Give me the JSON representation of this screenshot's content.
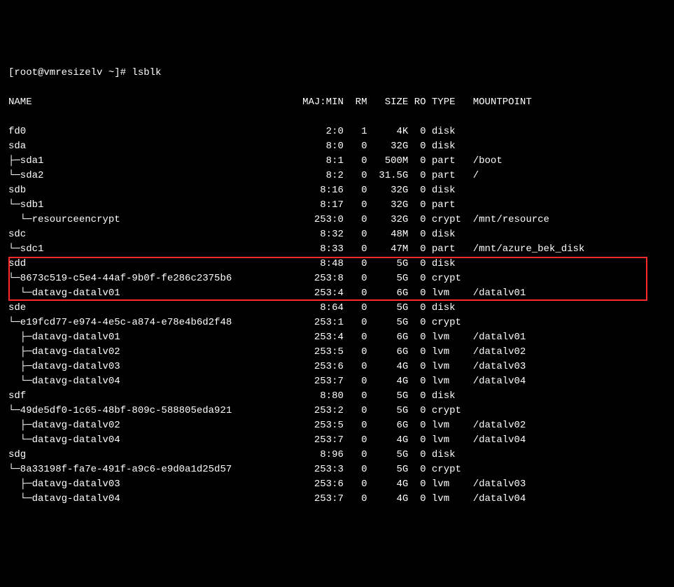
{
  "prompt": "[root@vmresizelv ~]# lsblk",
  "header": {
    "name": "NAME",
    "majmin": "MAJ:MIN",
    "rm": "RM",
    "size": "SIZE",
    "ro": "RO",
    "type": "TYPE",
    "mount": "MOUNTPOINT"
  },
  "rows": [
    {
      "tree": "",
      "name": "fd0",
      "majmin": "2:0",
      "rm": "1",
      "size": "4K",
      "ro": "0",
      "type": "disk",
      "mount": "",
      "hl": ""
    },
    {
      "tree": "",
      "name": "sda",
      "majmin": "8:0",
      "rm": "0",
      "size": "32G",
      "ro": "0",
      "type": "disk",
      "mount": "",
      "hl": ""
    },
    {
      "tree": "├─",
      "name": "sda1",
      "majmin": "8:1",
      "rm": "0",
      "size": "500M",
      "ro": "0",
      "type": "part",
      "mount": "/boot",
      "hl": ""
    },
    {
      "tree": "└─",
      "name": "sda2",
      "majmin": "8:2",
      "rm": "0",
      "size": "31.5G",
      "ro": "0",
      "type": "part",
      "mount": "/",
      "hl": ""
    },
    {
      "tree": "",
      "name": "sdb",
      "majmin": "8:16",
      "rm": "0",
      "size": "32G",
      "ro": "0",
      "type": "disk",
      "mount": "",
      "hl": ""
    },
    {
      "tree": "└─",
      "name": "sdb1",
      "majmin": "8:17",
      "rm": "0",
      "size": "32G",
      "ro": "0",
      "type": "part",
      "mount": "",
      "hl": ""
    },
    {
      "tree": "  └─",
      "name": "resourceencrypt",
      "majmin": "253:0",
      "rm": "0",
      "size": "32G",
      "ro": "0",
      "type": "crypt",
      "mount": "/mnt/resource",
      "hl": ""
    },
    {
      "tree": "",
      "name": "sdc",
      "majmin": "8:32",
      "rm": "0",
      "size": "48M",
      "ro": "0",
      "type": "disk",
      "mount": "",
      "hl": ""
    },
    {
      "tree": "└─",
      "name": "sdc1",
      "majmin": "8:33",
      "rm": "0",
      "size": "47M",
      "ro": "0",
      "type": "part",
      "mount": "/mnt/azure_bek_disk",
      "hl": ""
    },
    {
      "tree": "",
      "name": "sdd",
      "majmin": "8:48",
      "rm": "0",
      "size": "5G",
      "ro": "0",
      "type": "disk",
      "mount": "",
      "hl": "top"
    },
    {
      "tree": "└─",
      "name": "8673c519-c5e4-44af-9b0f-fe286c2375b6",
      "majmin": "253:8",
      "rm": "0",
      "size": "5G",
      "ro": "0",
      "type": "crypt",
      "mount": "",
      "hl": "mid"
    },
    {
      "tree": "  └─",
      "name": "datavg-datalv01",
      "majmin": "253:4",
      "rm": "0",
      "size": "6G",
      "ro": "0",
      "type": "lvm",
      "mount": "/datalv01",
      "hl": "bottom"
    },
    {
      "tree": "",
      "name": "sde",
      "majmin": "8:64",
      "rm": "0",
      "size": "5G",
      "ro": "0",
      "type": "disk",
      "mount": "",
      "hl": ""
    },
    {
      "tree": "└─",
      "name": "e19fcd77-e974-4e5c-a874-e78e4b6d2f48",
      "majmin": "253:1",
      "rm": "0",
      "size": "5G",
      "ro": "0",
      "type": "crypt",
      "mount": "",
      "hl": ""
    },
    {
      "tree": "  ├─",
      "name": "datavg-datalv01",
      "majmin": "253:4",
      "rm": "0",
      "size": "6G",
      "ro": "0",
      "type": "lvm",
      "mount": "/datalv01",
      "hl": ""
    },
    {
      "tree": "  ├─",
      "name": "datavg-datalv02",
      "majmin": "253:5",
      "rm": "0",
      "size": "6G",
      "ro": "0",
      "type": "lvm",
      "mount": "/datalv02",
      "hl": ""
    },
    {
      "tree": "  ├─",
      "name": "datavg-datalv03",
      "majmin": "253:6",
      "rm": "0",
      "size": "4G",
      "ro": "0",
      "type": "lvm",
      "mount": "/datalv03",
      "hl": ""
    },
    {
      "tree": "  └─",
      "name": "datavg-datalv04",
      "majmin": "253:7",
      "rm": "0",
      "size": "4G",
      "ro": "0",
      "type": "lvm",
      "mount": "/datalv04",
      "hl": ""
    },
    {
      "tree": "",
      "name": "sdf",
      "majmin": "8:80",
      "rm": "0",
      "size": "5G",
      "ro": "0",
      "type": "disk",
      "mount": "",
      "hl": ""
    },
    {
      "tree": "└─",
      "name": "49de5df0-1c65-48bf-809c-588805eda921",
      "majmin": "253:2",
      "rm": "0",
      "size": "5G",
      "ro": "0",
      "type": "crypt",
      "mount": "",
      "hl": ""
    },
    {
      "tree": "  ├─",
      "name": "datavg-datalv02",
      "majmin": "253:5",
      "rm": "0",
      "size": "6G",
      "ro": "0",
      "type": "lvm",
      "mount": "/datalv02",
      "hl": ""
    },
    {
      "tree": "  └─",
      "name": "datavg-datalv04",
      "majmin": "253:7",
      "rm": "0",
      "size": "4G",
      "ro": "0",
      "type": "lvm",
      "mount": "/datalv04",
      "hl": ""
    },
    {
      "tree": "",
      "name": "sdg",
      "majmin": "8:96",
      "rm": "0",
      "size": "5G",
      "ro": "0",
      "type": "disk",
      "mount": "",
      "hl": ""
    },
    {
      "tree": "└─",
      "name": "8a33198f-fa7e-491f-a9c6-e9d0a1d25d57",
      "majmin": "253:3",
      "rm": "0",
      "size": "5G",
      "ro": "0",
      "type": "crypt",
      "mount": "",
      "hl": ""
    },
    {
      "tree": "  ├─",
      "name": "datavg-datalv03",
      "majmin": "253:6",
      "rm": "0",
      "size": "4G",
      "ro": "0",
      "type": "lvm",
      "mount": "/datalv03",
      "hl": ""
    },
    {
      "tree": "  └─",
      "name": "datavg-datalv04",
      "majmin": "253:7",
      "rm": "0",
      "size": "4G",
      "ro": "0",
      "type": "lvm",
      "mount": "/datalv04",
      "hl": ""
    }
  ]
}
